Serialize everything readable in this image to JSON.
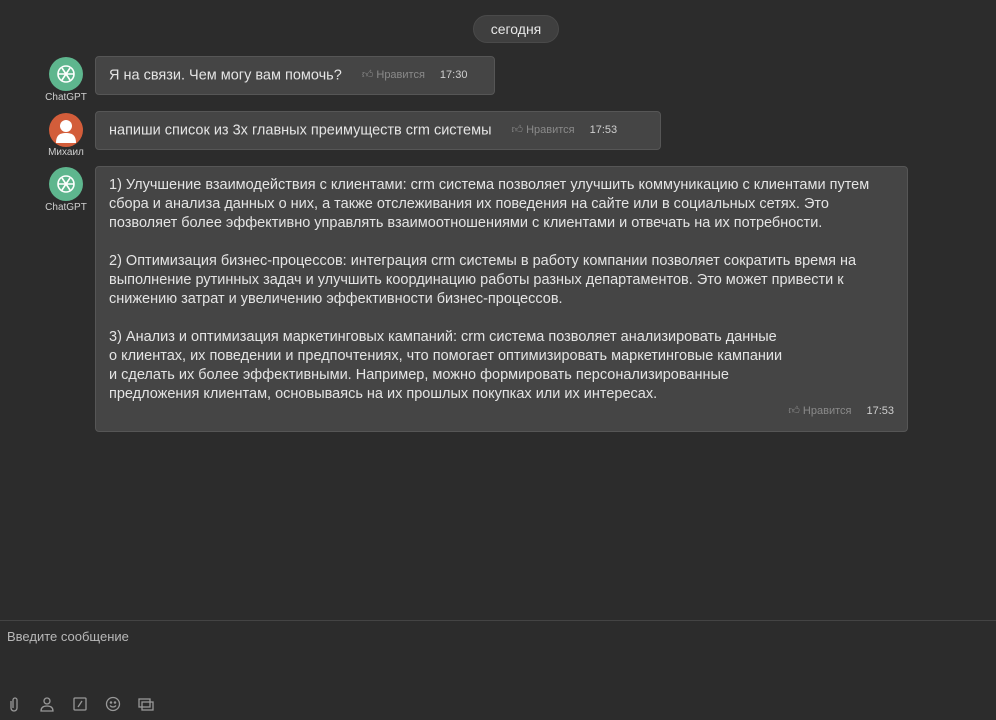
{
  "date_separator": "сегодня",
  "messages": [
    {
      "author": "ChatGPT",
      "text": "Я на связи. Чем могу вам помочь?",
      "like": "Нравится",
      "time": "17:30"
    },
    {
      "author": "Михаил",
      "text": "напиши список из 3х главных преимуществ crm системы",
      "like": "Нравится",
      "time": "17:53"
    },
    {
      "author": "ChatGPT",
      "paragraphs": [
        "1) Улучшение взаимодействия с клиентами: crm система позволяет улучшить коммуникацию с клиентами путем сбора и анализа данных о них, а также отслеживания их поведения на сайте или в социальных сетях. Это позволяет более эффективно управлять взаимоотношениями с клиентами и отвечать на их потребности.",
        "2) Оптимизация бизнес-процессов: интеграция crm системы в работу компании позволяет сократить время на выполнение рутинных задач и улучшить координацию работы разных департаментов. Это может привести к снижению затрат и увеличению эффективности бизнес-процессов.",
        "3) Анализ и оптимизация маркетинговых кампаний: crm система позволяет анализировать данные о клиентах, их поведении и предпочтениях, что помогает оптимизировать маркетинговые кампании и сделать их более эффективными. Например, можно формировать персонализированные предложения клиентам, основываясь на их прошлых покупках или их интересах."
      ],
      "like": "Нравится",
      "time": "17:53"
    }
  ],
  "composer": {
    "placeholder": "Введите сообщение"
  }
}
